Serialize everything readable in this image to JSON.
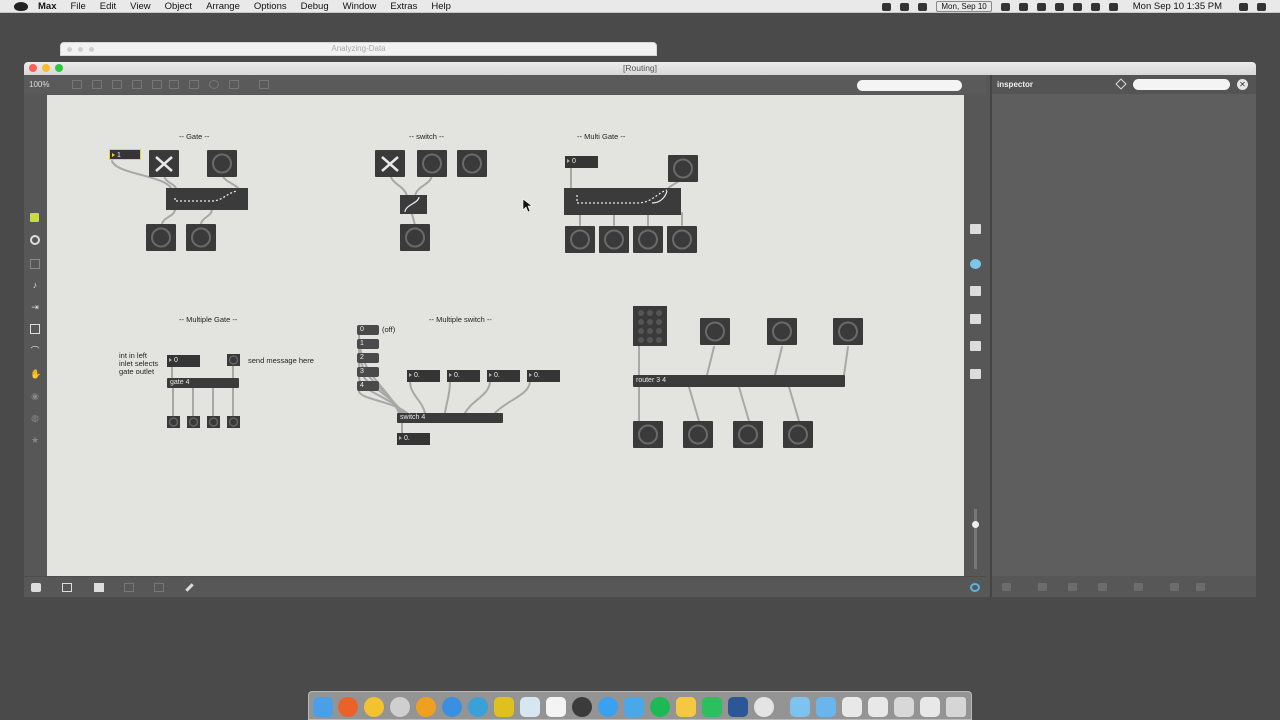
{
  "menubar": {
    "app": "Max",
    "items": [
      "File",
      "Edit",
      "View",
      "Object",
      "Arrange",
      "Options",
      "Debug",
      "Window",
      "Extras",
      "Help"
    ],
    "date_box": "Mon, Sep 10",
    "clock": "Mon Sep 10  1:35 PM"
  },
  "background_window": {
    "title": "Analyzing-Data"
  },
  "window": {
    "title": "[Routing]",
    "zoom": "100%",
    "inspector_title": "inspector"
  },
  "patch": {
    "comments": {
      "gate": "-- Gate --",
      "switch": "-- switch --",
      "multi_gate": "-- Multi Gate --",
      "multiple_gate": "-- Multiple  Gate --",
      "multiple_switch": "-- Multiple  switch --",
      "int_left_1": "int in left",
      "int_left_2": "inlet selects",
      "int_left_3": "gate outlet",
      "send_msg": "send message here",
      "off": "(off)"
    },
    "numbers": {
      "gate_num": "1",
      "multigate_num": "0",
      "mgate_num": "0",
      "sw_in_1": "0.",
      "sw_in_2": "0.",
      "sw_in_3": "0.",
      "sw_in_4": "0.",
      "sw_out": "0."
    },
    "messages": [
      "0",
      "1",
      "2",
      "3",
      "4"
    ],
    "objects": {
      "gate4": "gate 4",
      "switch4": "switch 4",
      "router": "router 3 4"
    }
  },
  "colors": {
    "canvas": "#e3e3df",
    "object": "#3b3b3b",
    "accent_yellow": "#e6d52a",
    "patch_cord": "#a8a8a8"
  }
}
